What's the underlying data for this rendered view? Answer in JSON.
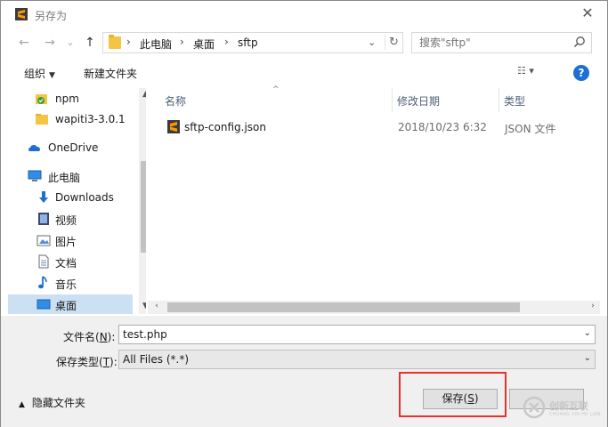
{
  "window": {
    "title": "另存为",
    "close_glyph": "✕"
  },
  "nav": {
    "back_glyph": "←",
    "forward_glyph": "→",
    "recent_glyph": "⌄",
    "up_glyph": "↑",
    "breadcrumbs": [
      "此电脑",
      "桌面",
      "sftp"
    ],
    "separator": "›",
    "dropdown_glyph": "⌄",
    "refresh_glyph": "↻",
    "search_placeholder": "搜索\"sftp\""
  },
  "toolbar": {
    "organize_label": "组织",
    "organize_caret": "▼",
    "new_folder_label": "新建文件夹",
    "view_glyph": "☷ ▾",
    "help_glyph": "?"
  },
  "sidebar": {
    "items": [
      {
        "label": "npm",
        "icon": "npm-folder-icon"
      },
      {
        "label": "wapiti3-3.0.1",
        "icon": "folder-icon"
      },
      {
        "label": "OneDrive",
        "icon": "cloud-icon"
      },
      {
        "label": "此电脑",
        "icon": "computer-icon"
      },
      {
        "label": "Downloads",
        "icon": "download-icon"
      },
      {
        "label": "视频",
        "icon": "video-icon"
      },
      {
        "label": "图片",
        "icon": "picture-icon"
      },
      {
        "label": "文档",
        "icon": "document-icon"
      },
      {
        "label": "音乐",
        "icon": "music-icon"
      },
      {
        "label": "桌面",
        "icon": "desktop-icon"
      }
    ],
    "scroll_up": "▲",
    "scroll_down": "▼"
  },
  "columns": {
    "name": "名称",
    "modified": "修改日期",
    "type": "类型",
    "sort_glyph": "^"
  },
  "files": [
    {
      "name": "sftp-config.json",
      "modified": "2018/10/23 6:32",
      "type": "JSON 文件"
    }
  ],
  "hscroll": {
    "left": "‹",
    "right": "›"
  },
  "form": {
    "filename_label_prefix": "文件名(",
    "filename_label_key": "N",
    "filename_label_suffix": "):",
    "filename_value": "test.php",
    "filetype_label_prefix": "保存类型(",
    "filetype_label_key": "T",
    "filetype_label_suffix": "):",
    "filetype_value": "All Files (*.*)",
    "combo_glyph": "⌄"
  },
  "footer": {
    "hide_folders_glyph": "▲",
    "hide_folders_label": "隐藏文件夹",
    "save_label_prefix": "保存(",
    "save_label_key": "S",
    "save_label_suffix": ")"
  },
  "watermark": {
    "brand": "创新互联",
    "sub": "CHUANG XIN HU LIAN"
  },
  "colors": {
    "accent": "#1e6fd1",
    "selection": "#cce0f4",
    "highlight_border": "#e8312a"
  }
}
